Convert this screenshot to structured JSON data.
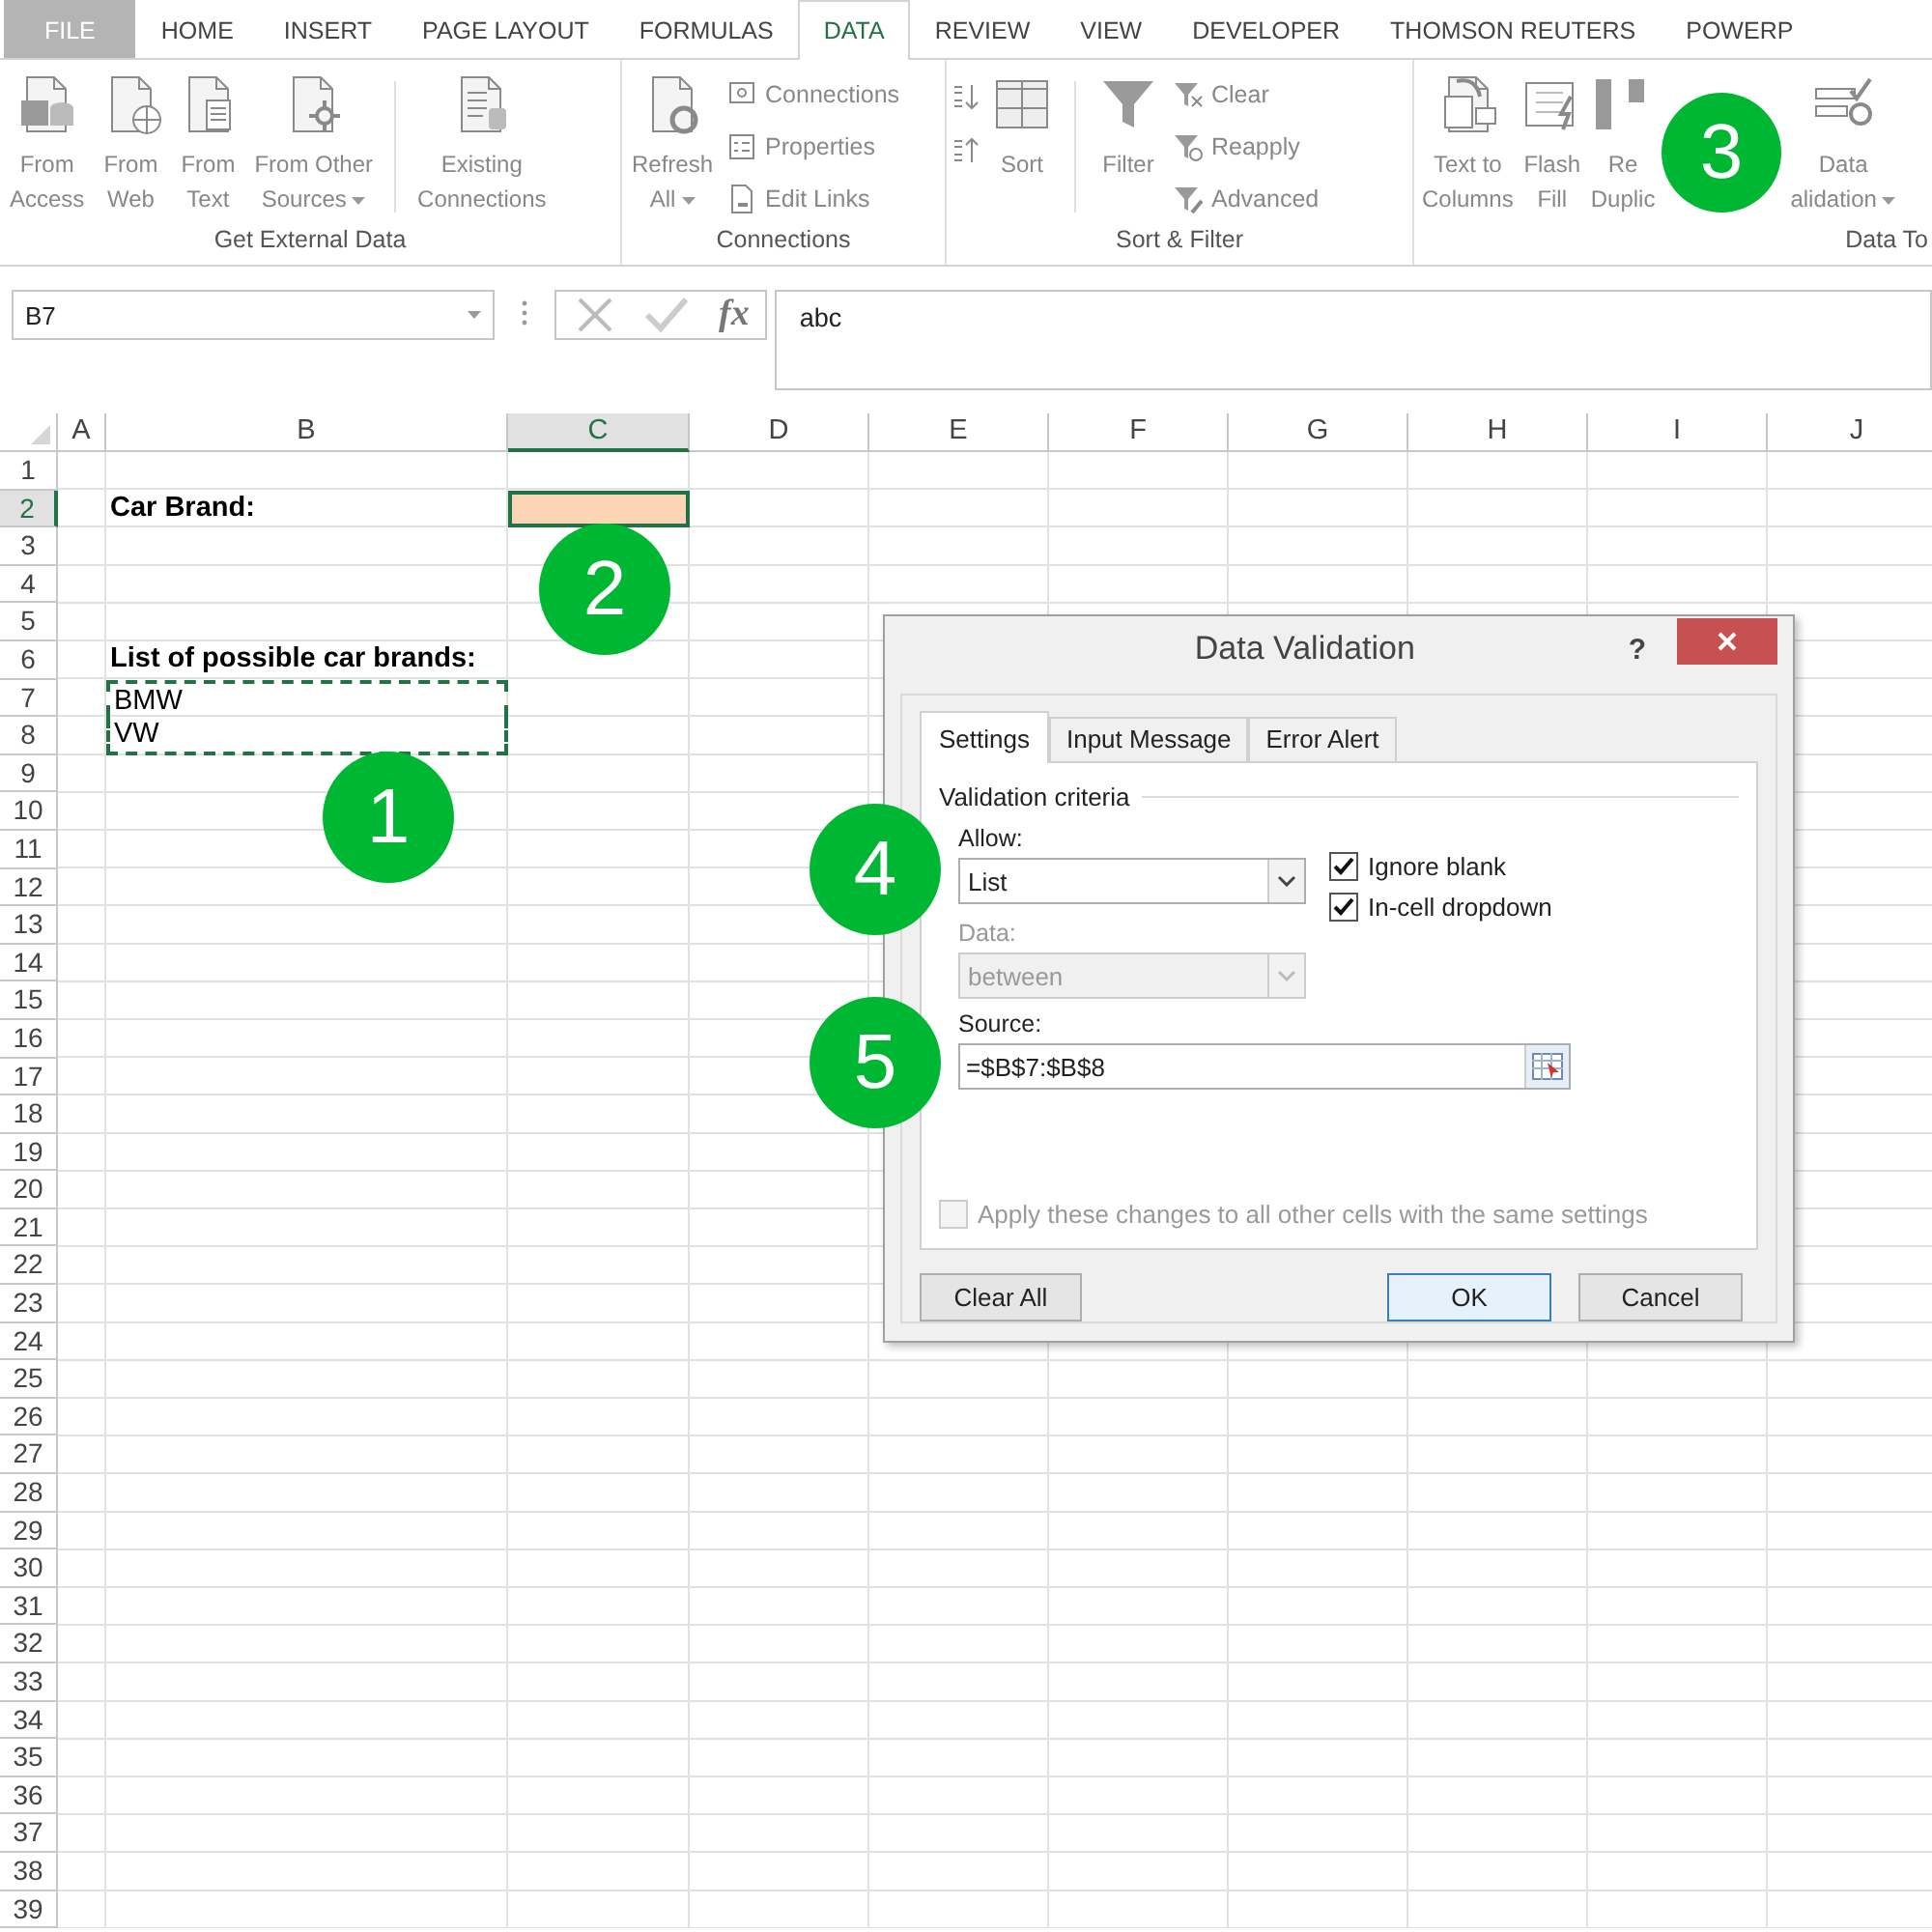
{
  "ribbon_tabs": [
    {
      "label": "FILE",
      "kind": "file",
      "selected": false
    },
    {
      "label": "HOME",
      "kind": "tab",
      "selected": false
    },
    {
      "label": "INSERT",
      "kind": "tab",
      "selected": false
    },
    {
      "label": "PAGE LAYOUT",
      "kind": "tab",
      "selected": false
    },
    {
      "label": "FORMULAS",
      "kind": "tab",
      "selected": false
    },
    {
      "label": "DATA",
      "kind": "tab",
      "selected": true
    },
    {
      "label": "REVIEW",
      "kind": "tab",
      "selected": false
    },
    {
      "label": "VIEW",
      "kind": "tab",
      "selected": false
    },
    {
      "label": "DEVELOPER",
      "kind": "tab",
      "selected": false
    },
    {
      "label": "THOMSON REUTERS",
      "kind": "tab",
      "selected": false
    },
    {
      "label": "POWERP",
      "kind": "tab",
      "selected": false
    }
  ],
  "ribbon_groups": [
    {
      "label": "Get External Data",
      "items": [
        {
          "kind": "large",
          "label": "From\nAccess",
          "dropdown": false
        },
        {
          "kind": "large",
          "label": "From\nWeb",
          "dropdown": false
        },
        {
          "kind": "large",
          "label": "From\nText",
          "dropdown": false
        },
        {
          "kind": "large",
          "label": "From Other\nSources",
          "dropdown": true
        },
        {
          "kind": "separator"
        },
        {
          "kind": "large",
          "label": "Existing\nConnections",
          "dropdown": false
        }
      ]
    },
    {
      "label": "Connections",
      "items": [
        {
          "kind": "large",
          "label": "Refresh\nAll",
          "dropdown": true
        },
        {
          "kind": "stack",
          "items": [
            {
              "label": "Connections"
            },
            {
              "label": "Properties"
            },
            {
              "label": "Edit Links"
            }
          ]
        }
      ]
    },
    {
      "label": "Sort & Filter",
      "items": [
        {
          "kind": "sort_pair"
        },
        {
          "kind": "large",
          "label": "Sort",
          "dropdown": false
        },
        {
          "kind": "separator"
        },
        {
          "kind": "large",
          "label": "Filter",
          "dropdown": false
        },
        {
          "kind": "stack",
          "items": [
            {
              "label": "Clear"
            },
            {
              "label": "Reapply"
            },
            {
              "label": "Advanced"
            }
          ]
        }
      ]
    },
    {
      "label": "Data To",
      "items": [
        {
          "kind": "large",
          "label": "Text to\nColumns",
          "dropdown": false
        },
        {
          "kind": "large",
          "label": "Flash\nFill",
          "dropdown": false
        },
        {
          "kind": "large",
          "label": "Re\nDuplic",
          "dropdown": false
        },
        {
          "kind": "large",
          "label": "Data\nalidation",
          "dropdown": true
        }
      ]
    }
  ],
  "formula_bar": {
    "name_box": "B7",
    "function_label": "fx",
    "formula": "abc"
  },
  "sheet": {
    "columns": [
      {
        "label": "A",
        "selected": false
      },
      {
        "label": "B",
        "selected": false
      },
      {
        "label": "C",
        "selected": true
      },
      {
        "label": "D",
        "selected": false
      },
      {
        "label": "E",
        "selected": false
      },
      {
        "label": "F",
        "selected": false
      },
      {
        "label": "G",
        "selected": false
      },
      {
        "label": "H",
        "selected": false
      },
      {
        "label": "I",
        "selected": false
      },
      {
        "label": "J",
        "selected": false
      }
    ],
    "rows": [
      {
        "number": "1",
        "selected": false,
        "marquee": false
      },
      {
        "number": "2",
        "selected": true,
        "marquee": false,
        "column_b": "Car Brand:",
        "bold": true
      },
      {
        "number": "3",
        "selected": false,
        "marquee": false
      },
      {
        "number": "4",
        "selected": false,
        "marquee": false
      },
      {
        "number": "5",
        "selected": false,
        "marquee": false
      },
      {
        "number": "6",
        "selected": false,
        "marquee": false,
        "column_b": "List of possible car brands:",
        "bold": true
      },
      {
        "number": "7",
        "selected": false,
        "marquee": true,
        "column_b": "BMW",
        "bold": false
      },
      {
        "number": "8",
        "selected": false,
        "marquee": true,
        "column_b": "VW",
        "bold": false
      },
      {
        "number": "9",
        "selected": false,
        "marquee": false
      },
      {
        "number": "10",
        "selected": false,
        "marquee": false
      },
      {
        "number": "11",
        "selected": false,
        "marquee": false
      },
      {
        "number": "12",
        "selected": false,
        "marquee": false
      },
      {
        "number": "13",
        "selected": false,
        "marquee": false
      },
      {
        "number": "14",
        "selected": false,
        "marquee": false
      },
      {
        "number": "15",
        "selected": false,
        "marquee": false
      },
      {
        "number": "16",
        "selected": false,
        "marquee": false
      },
      {
        "number": "17",
        "selected": false,
        "marquee": false
      },
      {
        "number": "18",
        "selected": false,
        "marquee": false
      },
      {
        "number": "19",
        "selected": false,
        "marquee": false
      },
      {
        "number": "20",
        "selected": false,
        "marquee": false
      },
      {
        "number": "21",
        "selected": false,
        "marquee": false
      },
      {
        "number": "22",
        "selected": false,
        "marquee": false
      },
      {
        "number": "23",
        "selected": false,
        "marquee": false
      },
      {
        "number": "24",
        "selected": false,
        "marquee": false
      },
      {
        "number": "25",
        "selected": false,
        "marquee": false
      },
      {
        "number": "26",
        "selected": false,
        "marquee": false
      },
      {
        "number": "27",
        "selected": false,
        "marquee": false
      },
      {
        "number": "28",
        "selected": false,
        "marquee": false
      },
      {
        "number": "29",
        "selected": false,
        "marquee": false
      },
      {
        "number": "30",
        "selected": false,
        "marquee": false
      },
      {
        "number": "31",
        "selected": false,
        "marquee": false
      },
      {
        "number": "32",
        "selected": false,
        "marquee": false
      },
      {
        "number": "33",
        "selected": false,
        "marquee": false
      },
      {
        "number": "34",
        "selected": false,
        "marquee": false
      },
      {
        "number": "35",
        "selected": false,
        "marquee": false
      },
      {
        "number": "36",
        "selected": false,
        "marquee": false
      },
      {
        "number": "37",
        "selected": false,
        "marquee": false
      },
      {
        "number": "38",
        "selected": false,
        "marquee": false
      },
      {
        "number": "39",
        "selected": false,
        "marquee": false
      }
    ]
  },
  "dialog": {
    "title": "Data Validation",
    "help": "?",
    "tabs": [
      {
        "label": "Settings",
        "selected": true
      },
      {
        "label": "Input Message",
        "selected": false
      },
      {
        "label": "Error Alert",
        "selected": false
      }
    ],
    "section": "Validation criteria",
    "allow": {
      "label": "Allow:",
      "value": "List",
      "disabled": false
    },
    "checkboxes": [
      {
        "label": "Ignore blank",
        "checked": true
      },
      {
        "label": "In-cell dropdown",
        "checked": true
      }
    ],
    "data": {
      "label": "Data:",
      "value": "between",
      "disabled": true
    },
    "source": {
      "label": "Source:",
      "value": "=$B$7:$B$8"
    },
    "apply_all": {
      "label": "Apply these changes to all other cells with the same settings",
      "checked": false,
      "disabled": true
    },
    "buttons": [
      {
        "label": "Clear All",
        "default": false
      },
      {
        "label": "OK",
        "default": true
      },
      {
        "label": "Cancel",
        "default": false
      }
    ]
  },
  "annotations": [
    {
      "label": "1"
    },
    {
      "label": "2"
    },
    {
      "label": "3"
    },
    {
      "label": "4"
    },
    {
      "label": "5"
    }
  ]
}
